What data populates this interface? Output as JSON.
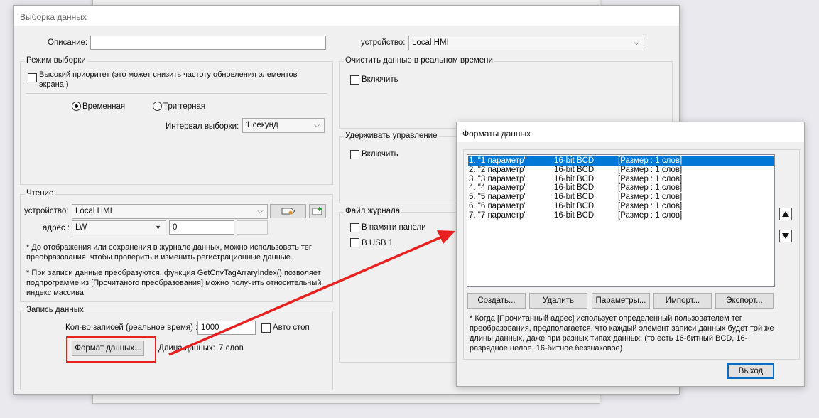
{
  "main": {
    "title": "Выборка данных",
    "description_label": "Описание:",
    "description_value": "",
    "device_label": "устройство:",
    "device_value": "Local HMI",
    "mode": {
      "title": "Режим выборки",
      "high_priority": "Высокий приоритет (это может снизить частоту обновления элементов экрана.)",
      "radio_time": "Временная",
      "radio_trigger": "Триггерная",
      "interval_label": "Интервал выборки:",
      "interval_value": "1 секунд"
    },
    "clear": {
      "title": "Очистить данные в реальном времени",
      "enable": "Включить"
    },
    "hold": {
      "title": "Удерживать управление",
      "enable": "Включить"
    },
    "read": {
      "title": "Чтение",
      "device_label": "устройство:",
      "device_value": "Local HMI",
      "address_label": "адрес :",
      "address_type": "LW",
      "address_value": "0",
      "note1": "* До отображения или сохранения в журнале данных, можно использовать тег преобразования, чтобы проверить и изменить регистрационные данные.",
      "note2": "* При записи данные преобразуются, функция GetCnvTagArraryIndex() позволяет подпрограмме из [Прочитаного преобразования] можно получить относительный индекс массива."
    },
    "log": {
      "title": "Файл журнала",
      "panel_memory": "В памяти панели",
      "usb": "В USB 1"
    },
    "record": {
      "title": "Запись данных",
      "count_label": "Кол-во записей (реальное время) :",
      "count_value": "1000",
      "auto_stop": "Авто стоп",
      "format_button": "Формат данных...",
      "length_label": "Длина данных:",
      "length_value": "7 слов"
    }
  },
  "formats": {
    "title": "Форматы данных",
    "items": [
      {
        "name": "1. \"1 параметр\"",
        "type": "16-bit BCD",
        "size": "[Размер : 1 слов]",
        "selected": true
      },
      {
        "name": "2. \"2 параметр\"",
        "type": "16-bit BCD",
        "size": "[Размер : 1 слов]",
        "selected": false
      },
      {
        "name": "3. \"3 параметр\"",
        "type": "16-bit BCD",
        "size": "[Размер : 1 слов]",
        "selected": false
      },
      {
        "name": "4. \"4 параметр\"",
        "type": "16-bit BCD",
        "size": "[Размер : 1 слов]",
        "selected": false
      },
      {
        "name": "5. \"5 параметр\"",
        "type": "16-bit BCD",
        "size": "[Размер : 1 слов]",
        "selected": false
      },
      {
        "name": "6. \"6 параметр\"",
        "type": "16-bit BCD",
        "size": "[Размер : 1 слов]",
        "selected": false
      },
      {
        "name": "7. \"7 параметр\"",
        "type": "16-bit BCD",
        "size": "[Размер : 1 слов]",
        "selected": false
      }
    ],
    "buttons": {
      "create": "Создать...",
      "delete": "Удалить",
      "params": "Параметры...",
      "import": "Импорт...",
      "export": "Экспорт..."
    },
    "note": "* Когда [Прочитанный адрес] использует определенный пользователем тег преобразования, предполагается, что каждый элемент записи данных будет той же длины данных, даже при разных типах данных. (то есть 16-битный BCD, 16-разрядное целое, 16-битное беззнаковое)",
    "exit": "Выход"
  },
  "colors": {
    "annotation": "#e8201f",
    "selection": "#0078d7"
  }
}
